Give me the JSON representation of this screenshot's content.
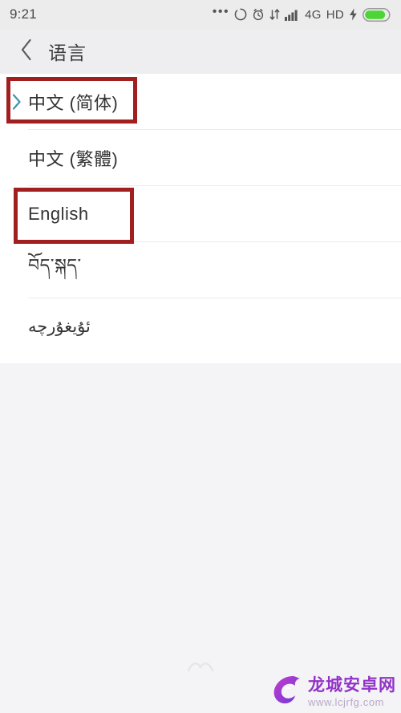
{
  "status_bar": {
    "time": "9:21",
    "more_dots": "•••",
    "icons": [
      {
        "name": "sync-circle-icon"
      },
      {
        "name": "alarm-clock-icon"
      },
      {
        "name": "data-transfer-icon"
      },
      {
        "name": "signal-bars-icon"
      }
    ],
    "network_type": "4G",
    "hd_label": "HD",
    "charging_icon": "lightning-bolt-icon",
    "battery": {
      "name": "battery-icon",
      "color": "#4cd636",
      "level_percent": 85
    }
  },
  "app_bar": {
    "back_icon": "chevron-left-icon",
    "title": "语言"
  },
  "language_list": {
    "items": [
      {
        "label": "中文 (简体)",
        "selected": true,
        "indicator_icon": "chevron-right-icon",
        "indicator_color": "#3f93ab"
      },
      {
        "label": "中文 (繁體)",
        "selected": false
      },
      {
        "label": "English",
        "selected": false
      },
      {
        "label": "བོད་སྐད་",
        "selected": false
      },
      {
        "label": "ئۇيغۇرچە",
        "selected": false
      }
    ]
  },
  "annotations": {
    "color": "#a21f20",
    "boxes": [
      {
        "target": "中文 (简体)"
      },
      {
        "target": "English"
      }
    ]
  },
  "watermark": {
    "logo_icon": "dragon-logo-icon",
    "site_name": "龙城安卓网",
    "url": "www.lcjrfg.com",
    "brand_color": "#9333c8"
  },
  "nav_hint": {
    "icon": "home-gesture-icon"
  }
}
